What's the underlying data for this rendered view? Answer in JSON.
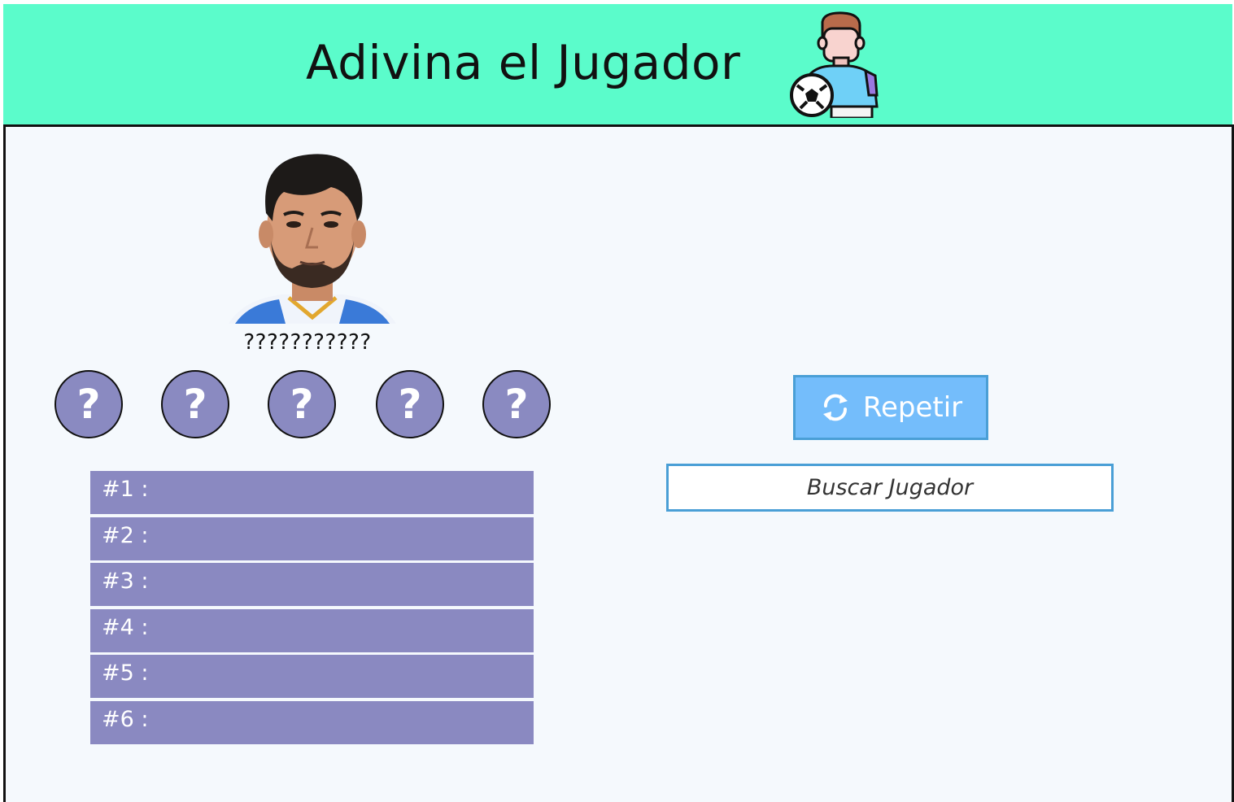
{
  "header": {
    "title": "Adivina el Jugador",
    "icon": "football-player-icon",
    "background": "#5bfccb"
  },
  "game": {
    "mystery_name": "???????????",
    "hints": [
      "?",
      "?",
      "?",
      "?",
      "?"
    ],
    "hint_color": "#8a8ac1",
    "guesses": [
      {
        "label": "#1 :",
        "value": ""
      },
      {
        "label": "#2 :",
        "value": ""
      },
      {
        "label": "#3 :",
        "value": ""
      },
      {
        "label": "#4 :",
        "value": ""
      },
      {
        "label": "#5 :",
        "value": ""
      },
      {
        "label": "#6 :",
        "value": ""
      }
    ]
  },
  "controls": {
    "repeat_label": "Repetir",
    "repeat_icon": "refresh-icon",
    "search_placeholder": "Buscar Jugador",
    "accent": "#74bdfb"
  }
}
